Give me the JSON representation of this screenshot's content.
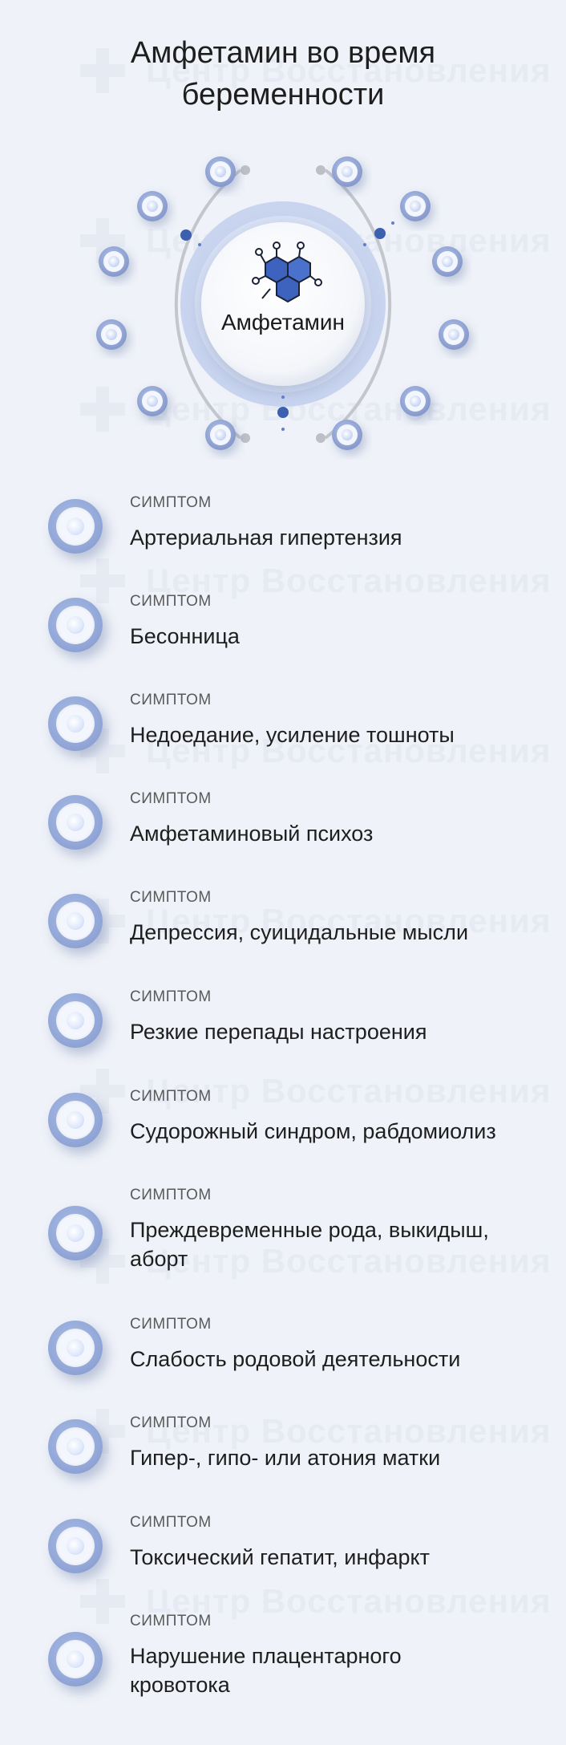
{
  "title_line1": "Амфетамин во время",
  "title_line2": "беременности",
  "center_label": "Амфетамин",
  "watermark": "Центр Восстановления",
  "colors": {
    "background": "#eff2f8",
    "accent": "#8fa4d6",
    "accent_dark": "#3d5fb0",
    "ring": "#c7c9cf"
  },
  "kicker_label": "СИМПТОМ",
  "symptoms": [
    {
      "kicker": "СИМПТОМ",
      "text": "Артериальная гипертензия"
    },
    {
      "kicker": "СИМПТОМ",
      "text": "Бесонница"
    },
    {
      "kicker": "СИМПТОМ",
      "text": "Недоедание,  усиление тошноты"
    },
    {
      "kicker": "СИМПТОМ",
      "text": "Амфетаминовый психоз"
    },
    {
      "kicker": "СИМПТОМ",
      "text": "Депрессия, суицидальные мысли"
    },
    {
      "kicker": "СИМПТОМ",
      "text": "Резкие перепады настроения"
    },
    {
      "kicker": "СИМПТОМ",
      "text": "Судорожный синдром, рабдомиолиз"
    },
    {
      "kicker": "СИМПТОМ",
      "text_line1": "Преждевременные рода, выкидыш,",
      "text_line2": "аборт"
    },
    {
      "kicker": "СИМПТОМ",
      "text": "Слабость родовой деятельности"
    },
    {
      "kicker": "СИМПТОМ",
      "text": "Гипер-, гипо- или атония матки"
    },
    {
      "kicker": "СИМПТОМ",
      "text": "Токсический гепатит, инфаркт"
    },
    {
      "kicker": "СИМПТОМ",
      "text_line1": "Нарушение плацентарного",
      "text_line2": "кровотока"
    }
  ]
}
